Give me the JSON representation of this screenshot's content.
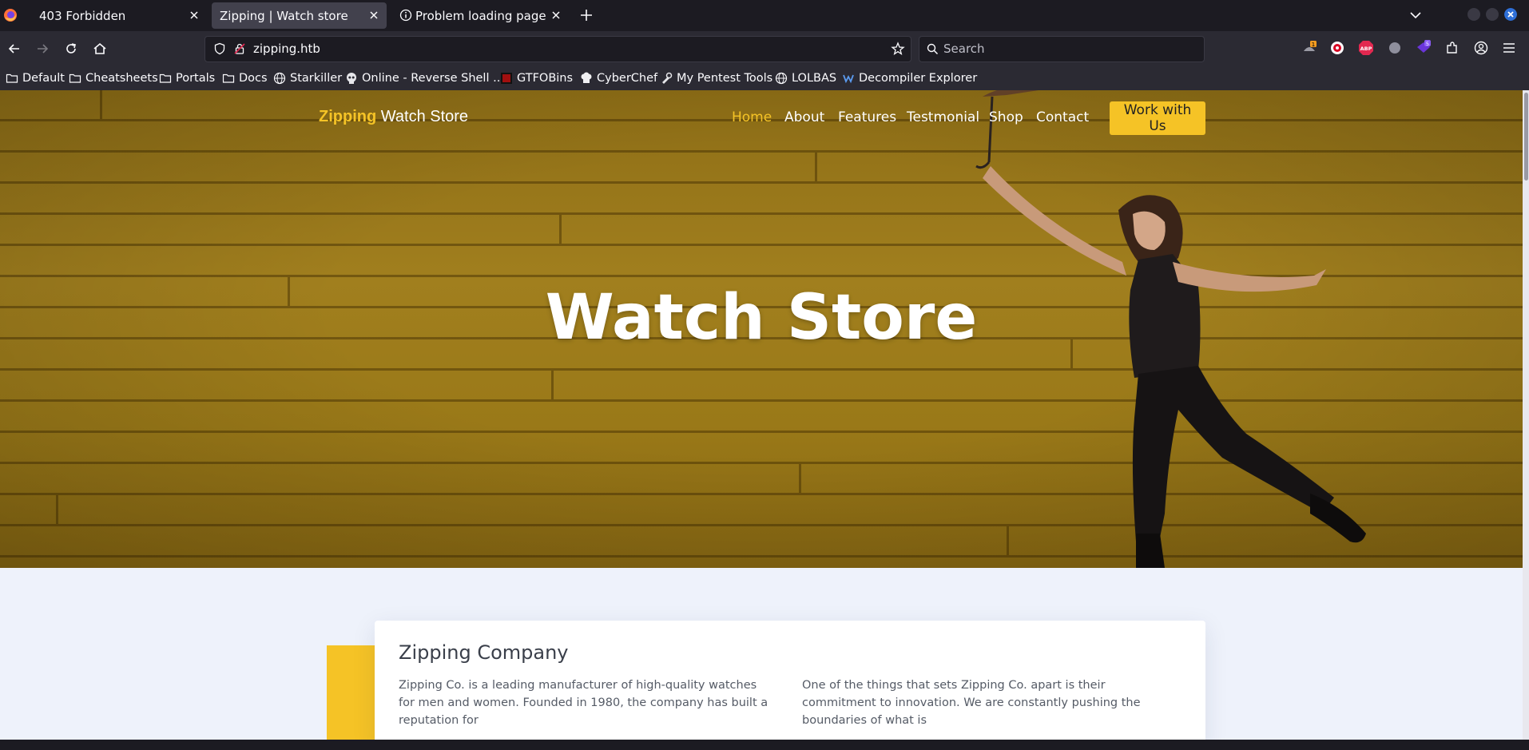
{
  "tabs": [
    {
      "label": "403 Forbidden",
      "active": false
    },
    {
      "label": "Zipping | Watch store",
      "active": true
    },
    {
      "label": "Problem loading page",
      "active": false
    }
  ],
  "urlbar": {
    "url": "zipping.htb"
  },
  "searchbar": {
    "placeholder": "Search"
  },
  "extensions": {
    "badge_count_1": "1",
    "badge_count_2": "5",
    "adblock_label": "ABP"
  },
  "bookmarks": [
    {
      "label": "Default",
      "icon": "folder-icon"
    },
    {
      "label": "Cheatsheets",
      "icon": "folder-icon"
    },
    {
      "label": "Portals",
      "icon": "folder-icon"
    },
    {
      "label": "Docs",
      "icon": "folder-icon"
    },
    {
      "label": "Starkiller",
      "icon": "globe-icon"
    },
    {
      "label": "Online - Reverse Shell ...",
      "icon": "skull-icon"
    },
    {
      "label": "GTFOBins",
      "icon": "gtfobins-icon"
    },
    {
      "label": "CyberChef",
      "icon": "chef-icon"
    },
    {
      "label": "My Pentest Tools",
      "icon": "tools-icon"
    },
    {
      "label": "LOLBAS",
      "icon": "globe-icon"
    },
    {
      "label": "Decompiler Explorer",
      "icon": "dogbolt-icon"
    }
  ],
  "site": {
    "brand_accent": "Zipping",
    "brand_rest": " Watch Store",
    "nav": [
      "Home",
      "About",
      "Features",
      "Testmonial",
      "Shop",
      "Contact"
    ],
    "cta_label": "Work with Us",
    "hero_title": "Watch Store",
    "about": {
      "heading": "Zipping Company",
      "col1": "Zipping Co. is a leading manufacturer of high-quality watches for men and women. Founded in 1980, the company has built a reputation for",
      "col2": "One of the things that sets Zipping Co. apart is their commitment to innovation. We are constantly pushing the boundaries of what is"
    }
  },
  "colors": {
    "accent": "#f5c326",
    "chrome_dark": "#1c1b22",
    "chrome": "#2b2a33",
    "active_tab": "#42414d"
  }
}
